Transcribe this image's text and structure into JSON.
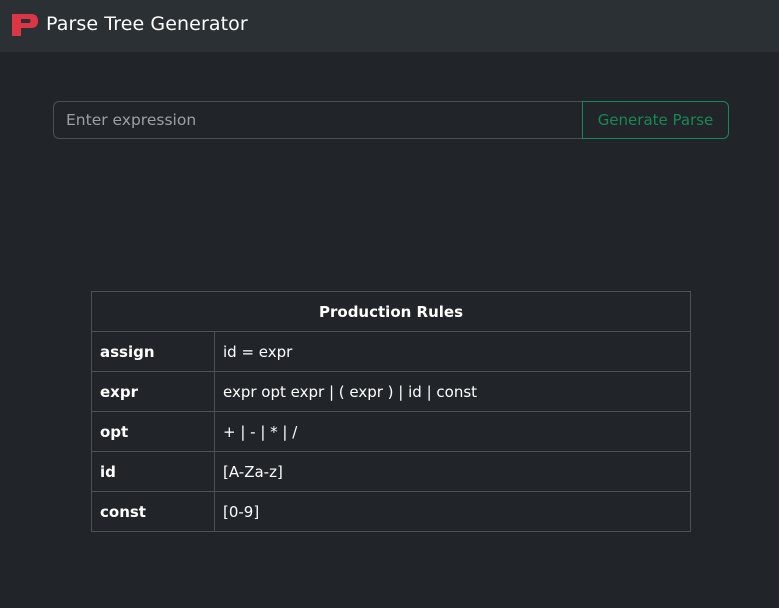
{
  "navbar": {
    "brand": "Parse Tree Generator",
    "logo_icon": "p-logo-icon",
    "logo_color": "#dc3545"
  },
  "form": {
    "placeholder": "Enter expression",
    "value": "",
    "button_label": "Generate Parse",
    "button_color": "#198754"
  },
  "rules": {
    "header": "Production Rules",
    "rows": [
      {
        "name": "assign",
        "definition": "id = expr"
      },
      {
        "name": "expr",
        "definition": "expr opt expr | ( expr ) | id | const"
      },
      {
        "name": "opt",
        "definition": "+ | - | * | /"
      },
      {
        "name": "id",
        "definition": "[A-Za-z]"
      },
      {
        "name": "const",
        "definition": "[0-9]"
      }
    ]
  }
}
